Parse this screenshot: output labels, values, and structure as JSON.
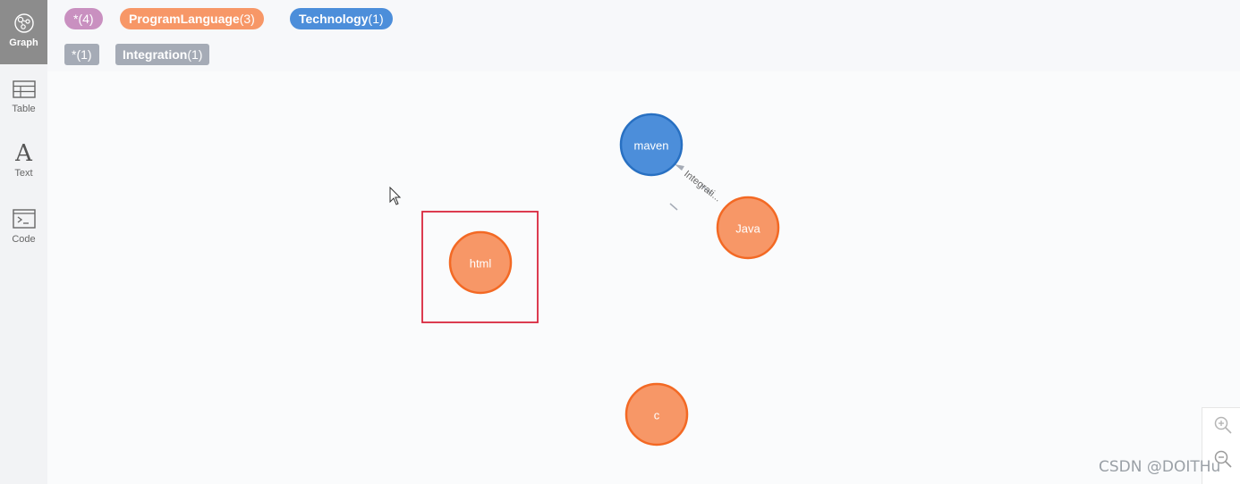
{
  "sidebar": {
    "items": [
      {
        "label": "Graph",
        "icon": "graph-icon",
        "active": true
      },
      {
        "label": "Table",
        "icon": "table-icon",
        "active": false
      },
      {
        "label": "Text",
        "icon": "text-icon",
        "glyph": "A",
        "active": false
      },
      {
        "label": "Code",
        "icon": "code-icon",
        "active": false
      }
    ]
  },
  "node_labels": [
    {
      "name": "*",
      "count": "(4)",
      "color": "#c990c0"
    },
    {
      "name": "ProgramLanguage",
      "count": "(3)",
      "color": "#f79767"
    },
    {
      "name": "Technology",
      "count": "(1)",
      "color": "#4c8eda"
    }
  ],
  "relationship_types": [
    {
      "name": "*",
      "count": "(1)",
      "color": "#a5abb6"
    },
    {
      "name": "Integration",
      "count": "(1)",
      "color": "#a5abb6"
    }
  ],
  "graph": {
    "nodes": [
      {
        "id": "maven",
        "label": "maven",
        "fill": "#4c8eda",
        "stroke": "#2870c2"
      },
      {
        "id": "java",
        "label": "Java",
        "fill": "#f79767",
        "stroke": "#f36924"
      },
      {
        "id": "html",
        "label": "html",
        "fill": "#f79767",
        "stroke": "#f36924",
        "highlighted": true
      },
      {
        "id": "c",
        "label": "c",
        "fill": "#f79767",
        "stroke": "#f36924"
      }
    ],
    "relationships": [
      {
        "from": "java",
        "to": "maven",
        "label": "Integrati..."
      }
    ],
    "highlight_color": "#d9263c"
  },
  "zoom": {
    "in_icon": "zoom-in-icon",
    "out_icon": "zoom-out-icon"
  },
  "watermark": "CSDN @DOITHu"
}
